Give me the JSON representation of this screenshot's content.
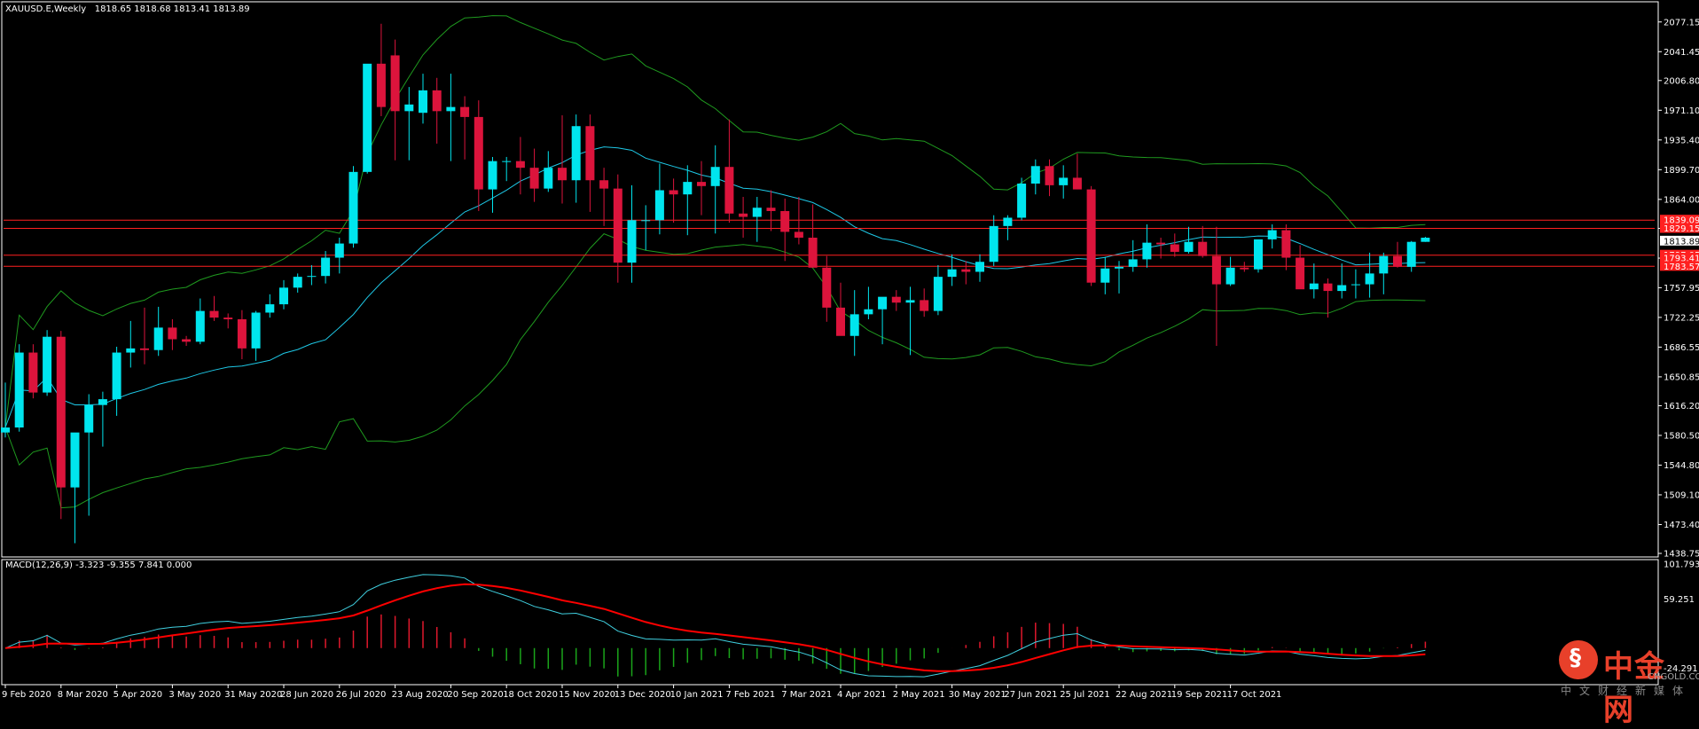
{
  "header": {
    "symbol": "XAUUSD.E,Weekly",
    "ohlc": "1818.65 1818.68 1813.41 1813.89"
  },
  "macd_header": "MACD(12,26,9) -3.323 -9.355 7.841 0.000",
  "logo": {
    "name": "中金网",
    "url": "CNGOLD.COM.CN",
    "tagline": "中文财经新媒体"
  },
  "colors": {
    "background": "#000000",
    "bull": "#00e5ee",
    "bear": "#dc143c",
    "bands": "#1f9a1f",
    "ma": "#1ec8e6",
    "level": "#ff2020",
    "macd_signal": "#ff0000",
    "macd_line": "#40d0e0",
    "hist_pos": "#e0182c",
    "hist_neg": "#1aa51a"
  },
  "chart_data": {
    "type": "candlestick",
    "ylim": [
      1438.75,
      2095.0
    ],
    "y_ticks": [
      "2077.15",
      "2041.45",
      "2006.80",
      "1971.10",
      "1935.40",
      "1899.70",
      "1864.00",
      "1829.15",
      "1793.45",
      "1757.95",
      "1722.25",
      "1686.55",
      "1650.85",
      "1616.20",
      "1580.50",
      "1544.80",
      "1509.10",
      "1473.40",
      "1438.75"
    ],
    "current_price": "1813.89",
    "price_flags": [
      "1839.09",
      "1829.15",
      "1797.05",
      "1793.41",
      "1783.57"
    ],
    "levels": [
      1839.1,
      1829.2,
      1797.0,
      1783.6
    ],
    "x_labels": [
      "9 Feb 2020",
      "8 Mar 2020",
      "5 Apr 2020",
      "3 May 2020",
      "31 May 2020",
      "28 Jun 2020",
      "26 Jul 2020",
      "23 Aug 2020",
      "20 Sep 2020",
      "18 Oct 2020",
      "15 Nov 2020",
      "13 Dec 2020",
      "10 Jan 2021",
      "7 Feb 2021",
      "7 Mar 2021",
      "4 Apr 2021",
      "2 May 2021",
      "30 May 2021",
      "27 Jun 2021",
      "25 Jul 2021",
      "22 Aug 2021",
      "19 Sep 2021",
      "17 Oct 2021"
    ],
    "candles": [
      [
        1584,
        1644,
        1578,
        1590
      ],
      [
        1590,
        1690,
        1585,
        1680
      ],
      [
        1680,
        1690,
        1625,
        1632
      ],
      [
        1632,
        1707,
        1628,
        1699
      ],
      [
        1699,
        1706,
        1480,
        1518
      ],
      [
        1518,
        1560,
        1451,
        1584
      ],
      [
        1584,
        1630,
        1484,
        1617
      ],
      [
        1617,
        1633,
        1567,
        1624
      ],
      [
        1624,
        1687,
        1604,
        1680
      ],
      [
        1680,
        1718,
        1662,
        1685
      ],
      [
        1685,
        1734,
        1666,
        1683
      ],
      [
        1683,
        1735,
        1676,
        1710
      ],
      [
        1710,
        1720,
        1683,
        1696
      ],
      [
        1696,
        1700,
        1688,
        1693
      ],
      [
        1693,
        1745,
        1690,
        1730
      ],
      [
        1730,
        1748,
        1718,
        1722
      ],
      [
        1722,
        1727,
        1709,
        1720
      ],
      [
        1720,
        1731,
        1672,
        1685
      ],
      [
        1685,
        1730,
        1670,
        1728
      ],
      [
        1728,
        1750,
        1722,
        1738
      ],
      [
        1738,
        1767,
        1732,
        1758
      ],
      [
        1758,
        1775,
        1752,
        1771
      ],
      [
        1771,
        1785,
        1761,
        1772
      ],
      [
        1772,
        1802,
        1763,
        1794
      ],
      [
        1794,
        1818,
        1775,
        1811
      ],
      [
        1811,
        1904,
        1806,
        1897
      ],
      [
        1897,
        1985,
        1895,
        2027
      ],
      [
        2027,
        2075,
        1964,
        1975
      ],
      [
        2037,
        2056,
        1911,
        1970
      ],
      [
        1970,
        1999,
        1911,
        1978
      ],
      [
        1968,
        2015,
        1955,
        1995
      ],
      [
        1995,
        2010,
        1931,
        1970
      ],
      [
        1970,
        2015,
        1910,
        1975
      ],
      [
        1975,
        1988,
        1912,
        1963
      ],
      [
        1963,
        1983,
        1850,
        1876
      ],
      [
        1876,
        1915,
        1848,
        1910
      ],
      [
        1910,
        1915,
        1886,
        1910
      ],
      [
        1910,
        1939,
        1870,
        1902
      ],
      [
        1902,
        1925,
        1861,
        1877
      ],
      [
        1877,
        1922,
        1873,
        1902
      ],
      [
        1902,
        1965,
        1859,
        1887
      ],
      [
        1887,
        1966,
        1860,
        1952
      ],
      [
        1952,
        1966,
        1849,
        1887
      ],
      [
        1887,
        1902,
        1832,
        1877
      ],
      [
        1877,
        1894,
        1764,
        1788
      ],
      [
        1788,
        1881,
        1764,
        1839
      ],
      [
        1839,
        1857,
        1803,
        1839
      ],
      [
        1839,
        1907,
        1822,
        1875
      ],
      [
        1875,
        1889,
        1836,
        1870
      ],
      [
        1870,
        1905,
        1821,
        1885
      ],
      [
        1885,
        1910,
        1845,
        1880
      ],
      [
        1880,
        1929,
        1823,
        1903
      ],
      [
        1903,
        1960,
        1836,
        1847
      ],
      [
        1847,
        1867,
        1818,
        1843
      ],
      [
        1843,
        1867,
        1813,
        1854
      ],
      [
        1854,
        1875,
        1826,
        1850
      ],
      [
        1850,
        1865,
        1790,
        1825
      ],
      [
        1825,
        1867,
        1810,
        1818
      ],
      [
        1818,
        1858,
        1785,
        1782
      ],
      [
        1782,
        1796,
        1717,
        1734
      ],
      [
        1734,
        1764,
        1702,
        1700
      ],
      [
        1700,
        1755,
        1676,
        1726
      ],
      [
        1726,
        1759,
        1720,
        1732
      ],
      [
        1732,
        1741,
        1690,
        1747
      ],
      [
        1747,
        1755,
        1730,
        1740
      ],
      [
        1740,
        1759,
        1677,
        1743
      ],
      [
        1743,
        1757,
        1723,
        1730
      ],
      [
        1730,
        1785,
        1725,
        1771
      ],
      [
        1771,
        1798,
        1760,
        1780
      ],
      [
        1780,
        1790,
        1762,
        1777
      ],
      [
        1777,
        1798,
        1765,
        1789
      ],
      [
        1789,
        1845,
        1784,
        1832
      ],
      [
        1832,
        1845,
        1815,
        1842
      ],
      [
        1842,
        1890,
        1839,
        1883
      ],
      [
        1883,
        1912,
        1870,
        1904
      ],
      [
        1904,
        1912,
        1868,
        1881
      ],
      [
        1881,
        1905,
        1865,
        1890
      ],
      [
        1890,
        1919,
        1876,
        1876
      ],
      [
        1876,
        1880,
        1760,
        1764
      ],
      [
        1764,
        1795,
        1750,
        1781
      ],
      [
        1781,
        1790,
        1751,
        1783
      ],
      [
        1783,
        1815,
        1777,
        1792
      ],
      [
        1792,
        1834,
        1782,
        1812
      ],
      [
        1812,
        1818,
        1793,
        1810
      ],
      [
        1810,
        1823,
        1795,
        1801
      ],
      [
        1801,
        1831,
        1799,
        1813
      ],
      [
        1813,
        1832,
        1794,
        1796
      ],
      [
        1796,
        1831,
        1688,
        1762
      ],
      [
        1762,
        1795,
        1760,
        1782
      ],
      [
        1782,
        1789,
        1777,
        1780
      ],
      [
        1780,
        1815,
        1776,
        1816
      ],
      [
        1816,
        1834,
        1805,
        1827
      ],
      [
        1827,
        1834,
        1779,
        1794
      ],
      [
        1794,
        1809,
        1770,
        1756
      ],
      [
        1756,
        1787,
        1745,
        1763
      ],
      [
        1763,
        1769,
        1722,
        1754
      ],
      [
        1754,
        1787,
        1745,
        1761
      ],
      [
        1761,
        1780,
        1745,
        1762
      ],
      [
        1762,
        1800,
        1746,
        1775
      ],
      [
        1775,
        1800,
        1750,
        1796
      ],
      [
        1796,
        1813,
        1782,
        1783
      ],
      [
        1783,
        1814,
        1777,
        1813
      ],
      [
        1813,
        1819,
        1813,
        1818
      ]
    ],
    "macd_ylim": [
      -40.0,
      101.793
    ],
    "macd_y_ticks": [
      "101.793",
      "59.251",
      "-24.291"
    ]
  }
}
